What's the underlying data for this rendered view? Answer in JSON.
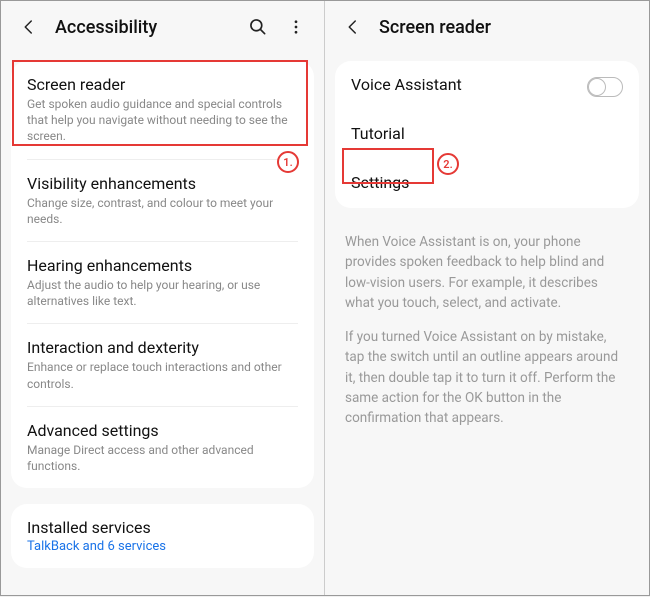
{
  "left": {
    "title": "Accessibility",
    "items": [
      {
        "title": "Screen reader",
        "sub": "Get spoken audio guidance and special controls that help you navigate without needing to see the screen."
      },
      {
        "title": "Visibility enhancements",
        "sub": "Change size, contrast, and colour to meet your needs."
      },
      {
        "title": "Hearing enhancements",
        "sub": "Adjust the audio to help your hearing, or use alternatives like text."
      },
      {
        "title": "Interaction and dexterity",
        "sub": "Enhance or replace touch interactions and other controls."
      },
      {
        "title": "Advanced settings",
        "sub": "Manage Direct access and other advanced functions."
      }
    ],
    "installed": {
      "title": "Installed services",
      "link": "TalkBack and 6 services"
    }
  },
  "right": {
    "title": "Screen reader",
    "items": [
      {
        "title": "Voice Assistant"
      },
      {
        "title": "Tutorial"
      },
      {
        "title": "Settings"
      }
    ],
    "desc1": "When Voice Assistant is on, your phone provides spoken feedback to help blind and low-vision users. For example, it describes what you touch, select, and activate.",
    "desc2": "If you turned Voice Assistant on by mistake, tap the switch until an outline appears around it, then double tap it to turn it off. Perform the same action for the OK button in the confirmation that appears."
  },
  "callouts": {
    "one": "1.",
    "two": "2."
  }
}
